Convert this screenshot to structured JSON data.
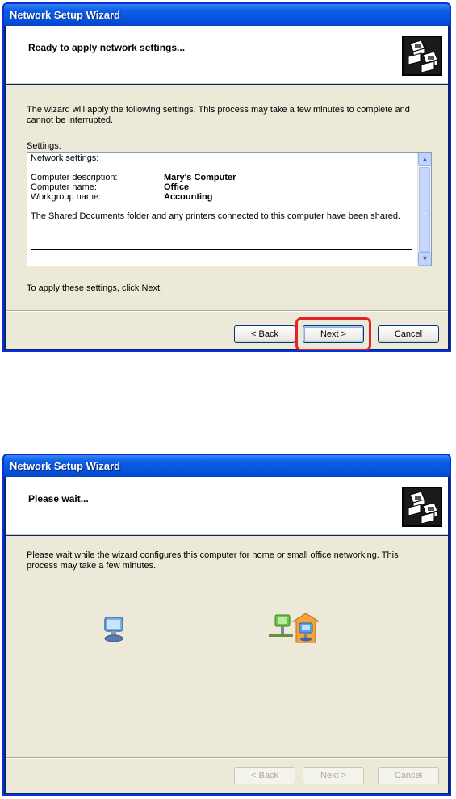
{
  "dialog1": {
    "window_title": "Network Setup Wizard",
    "header_title": "Ready to apply network settings...",
    "intro": "The wizard will apply the following settings. This process may take a few minutes to complete and cannot be interrupted.",
    "settings_label": "Settings:",
    "list": {
      "heading": "Network settings:",
      "rows": [
        {
          "label": "Computer description:",
          "value": "Mary's Computer"
        },
        {
          "label": "Computer name:",
          "value": "Office"
        },
        {
          "label": "Workgroup name:",
          "value": "Accounting"
        }
      ],
      "note": "The Shared Documents folder and any printers connected to this computer have been shared."
    },
    "instruction": "To apply these settings, click Next.",
    "buttons": {
      "back": "< Back",
      "next": "Next >",
      "cancel": "Cancel"
    },
    "highlight_color": "#e2242a"
  },
  "dialog2": {
    "window_title": "Network Setup Wizard",
    "header_title": "Please wait...",
    "intro": "Please wait while the wizard configures this computer for home or small office networking. This process may take a few minutes.",
    "buttons": {
      "back": "< Back",
      "next": "Next >",
      "cancel": "Cancel"
    },
    "buttons_disabled": true
  },
  "colors": {
    "titlebar": "#0654df",
    "dialog_bg": "#ece9d8",
    "header_bg": "#ffffff"
  }
}
